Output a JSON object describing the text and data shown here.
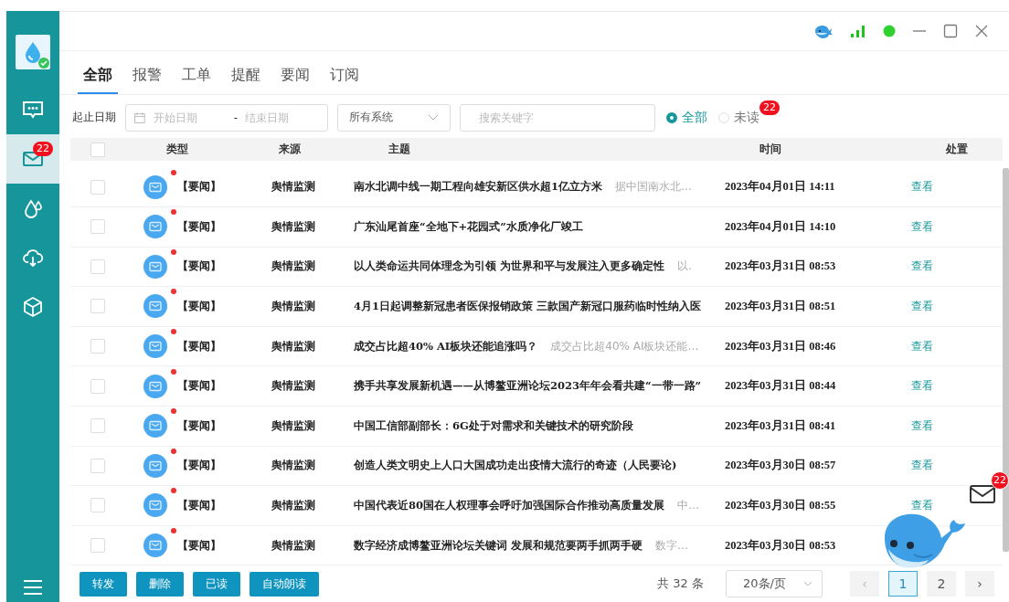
{
  "sidebar": {
    "items": [
      {
        "kind": "chat",
        "selected": false
      },
      {
        "kind": "mail",
        "selected": true,
        "badge": "22"
      },
      {
        "kind": "drop",
        "selected": false
      },
      {
        "kind": "cloud",
        "selected": false
      },
      {
        "kind": "cube",
        "selected": false
      }
    ]
  },
  "tabs": [
    {
      "label": "全部",
      "selected": true
    },
    {
      "label": "报警",
      "selected": false
    },
    {
      "label": "工单",
      "selected": false
    },
    {
      "label": "提醒",
      "selected": false
    },
    {
      "label": "要闻",
      "selected": false
    },
    {
      "label": "订阅",
      "selected": false
    }
  ],
  "filters": {
    "date_label": "起止日期",
    "start_placeholder": "开始日期",
    "separator": "-",
    "end_placeholder": "结束日期",
    "system": "所有系统",
    "search_placeholder": "搜索关键字",
    "read_options": [
      {
        "label": "全部",
        "selected": true
      },
      {
        "label": "未读",
        "selected": false,
        "badge": "22"
      }
    ]
  },
  "table": {
    "select_all": {
      "checked": false
    },
    "columns": [
      "类型",
      "来源",
      "主题",
      "时间",
      "处置"
    ],
    "rows": [
      {
        "checked": false,
        "unread": true,
        "type": "【要闻】",
        "source": "舆情监测",
        "subject": "南水北调中线一期工程向雄安新区供水超1亿立方米",
        "summary": "据中国南水北…",
        "time": "2023年04月01日 14:11",
        "action": "查看"
      },
      {
        "checked": false,
        "unread": true,
        "type": "【要闻】",
        "source": "舆情监测",
        "subject": "广东汕尾首座“全地下+花园式”水质净化厂竣工",
        "time": "2023年04月01日 14:10",
        "action": "查看"
      },
      {
        "checked": false,
        "unread": true,
        "type": "【要闻】",
        "source": "舆情监测",
        "subject": "以人类命运共同体理念为引领 为世界和平与发展注入更多确定性",
        "summary": "以.",
        "time": "2023年03月31日 08:53",
        "action": "查看"
      },
      {
        "checked": false,
        "unread": true,
        "type": "【要闻】",
        "source": "舆情监测",
        "subject": "4月1日起调整新冠患者医保报销政策 三款国产新冠口服药临时性纳入医",
        "time": "2023年03月31日 08:51",
        "action": "查看"
      },
      {
        "checked": false,
        "unread": true,
        "type": "【要闻】",
        "source": "舆情监测",
        "subject": "成交占比超40% AI板块还能追涨吗？",
        "summary": "成交占比超40% AI板块还能…",
        "time": "2023年03月31日 08:46",
        "action": "查看"
      },
      {
        "checked": false,
        "unread": true,
        "type": "【要闻】",
        "source": "舆情监测",
        "subject": "携手共享发展新机遇——从博鳌亚洲论坛2023年年会看共建“一带一路”",
        "time": "2023年03月31日 08:44",
        "action": "查看"
      },
      {
        "checked": false,
        "unread": true,
        "type": "【要闻】",
        "source": "舆情监测",
        "subject": "中国工信部副部长：6G处于对需求和关键技术的研究阶段",
        "time": "2023年03月31日 08:41",
        "action": "查看"
      },
      {
        "checked": false,
        "unread": true,
        "type": "【要闻】",
        "source": "舆情监测",
        "subject": "创造人类文明史上人口大国成功走出疫情大流行的奇迹（人民要论)",
        "time": "2023年03月30日 08:57",
        "action": "查看"
      },
      {
        "checked": false,
        "unread": true,
        "type": "【要闻】",
        "source": "舆情监测",
        "subject": "中国代表近80国在人权理事会呼吁加强国际合作推动高质量发展",
        "summary": "中…",
        "time": "2023年03月30日 08:55",
        "action": "查看"
      },
      {
        "checked": false,
        "unread": true,
        "type": "【要闻】",
        "source": "舆情监测",
        "subject": "数字经济成博鳌亚洲论坛关键词 发展和规范要两手抓两手硬",
        "summary": "数字…",
        "time": "2023年03月30日 08:53"
      }
    ]
  },
  "actions": [
    "转发",
    "删除",
    "已读",
    "自动朗读"
  ],
  "pagination": {
    "total": "共 32 条",
    "page_size": "20条/页",
    "prev": "‹",
    "pages": [
      {
        "label": "1",
        "selected": true
      },
      {
        "label": "2",
        "selected": false
      }
    ],
    "next": "›"
  },
  "floating_mail": {
    "badge": "22"
  }
}
